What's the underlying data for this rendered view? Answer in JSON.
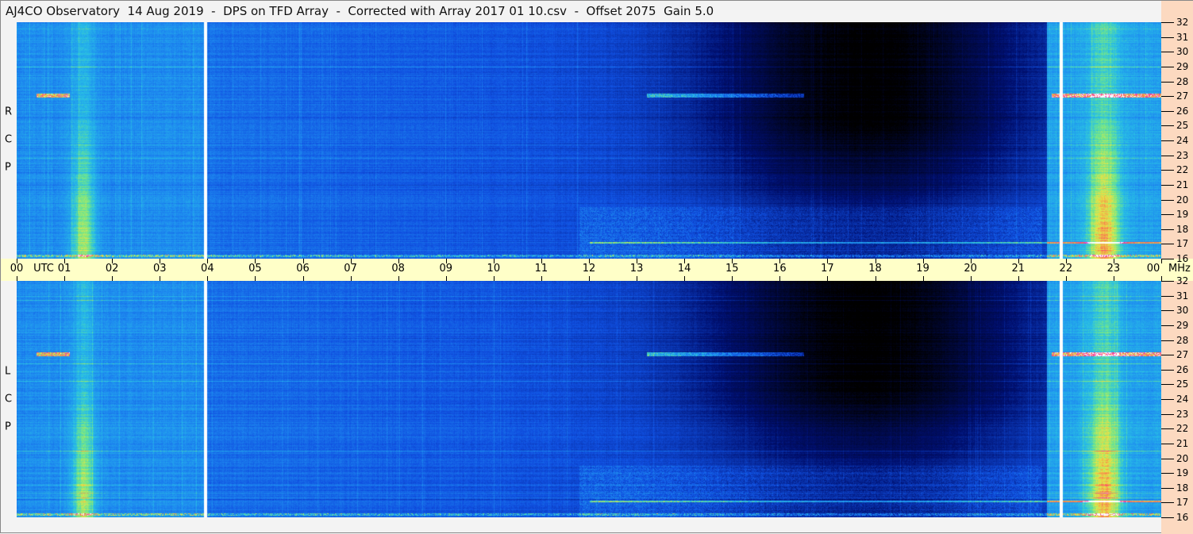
{
  "title": "AJ4CO Observatory  14 Aug 2019  -  DPS on TFD Array  -  Corrected with Array 2017 01 10.csv  -  Offset 2075  Gain 5.0",
  "chart_data": {
    "type": "heatmap",
    "title": "AJ4CO Observatory  14 Aug 2019  -  DPS on TFD Array  -  Corrected with Array 2017 01 10.csv  -  Offset 2075  Gain 5.0",
    "xlabel": "UTC",
    "ylabel": "MHz",
    "x_range": [
      0,
      24
    ],
    "y_range": [
      16,
      32
    ],
    "x_ticks": [
      "00",
      "01",
      "02",
      "03",
      "04",
      "05",
      "06",
      "07",
      "08",
      "09",
      "10",
      "11",
      "12",
      "13",
      "14",
      "15",
      "16",
      "17",
      "18",
      "19",
      "20",
      "21",
      "22",
      "23",
      "00"
    ],
    "y_ticks": [
      "32",
      "31",
      "30",
      "29",
      "28",
      "27",
      "26",
      "25",
      "24",
      "23",
      "22",
      "21",
      "20",
      "19",
      "18",
      "17",
      "16"
    ],
    "panels": [
      {
        "name": "R C P",
        "letters": [
          "R",
          "C",
          "P"
        ]
      },
      {
        "name": "L C P",
        "letters": [
          "L",
          "C",
          "P"
        ]
      }
    ],
    "data_gaps_utc": [
      3.95,
      21.9
    ]
  },
  "axis": {
    "utc_label": "UTC",
    "mhz_label": "MHz"
  }
}
